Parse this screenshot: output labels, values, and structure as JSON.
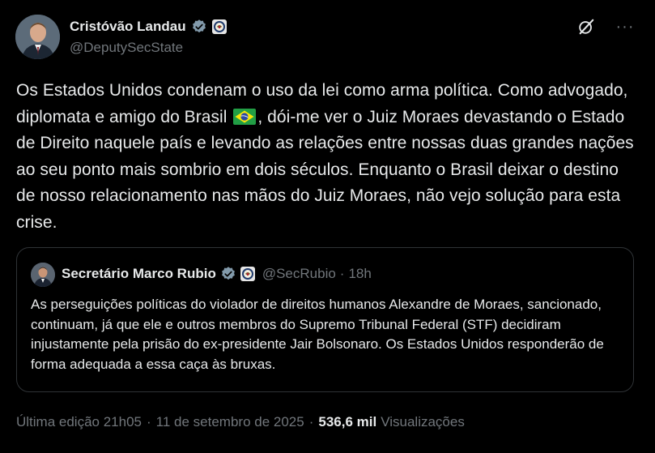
{
  "author": {
    "name": "Cristóvão Landau",
    "handle": "@DeputySecState"
  },
  "post": {
    "text_part1": "Os Estados Unidos condenam o uso da lei como arma política. Como advogado, diplomata e amigo do Brasil ",
    "text_part2": ", dói-me ver o Juiz Moraes devastando o Estado de Direito naquele país e levando as relações entre nossas duas grandes nações ao seu ponto mais sombrio em dois séculos. Enquanto o Brasil deixar o destino de nosso relacionamento nas mãos do Juiz Moraes, não vejo solução para esta crise."
  },
  "quoted": {
    "name": "Secretário Marco Rubio",
    "handle": "@SecRubio",
    "dot": "·",
    "time": "18h",
    "text": "As perseguições políticas do violador de direitos humanos Alexandre de Moraes, sancionado, continuam, já que ele e outros membros do Supremo Tribunal Federal (STF) decidiram injustamente pela prisão do ex-presidente Jair Bolsonaro. Os Estados Unidos responderão de forma adequada a essa caça às bruxas."
  },
  "meta": {
    "edited": "Última edição 21h05",
    "dot": "·",
    "date": "11 de setembro de 2025",
    "dot2": "·",
    "views_count": "536,6 mil",
    "views_label": "Visualizações"
  },
  "colors": {
    "background": "#000000",
    "text": "#e7e9ea",
    "secondary": "#71767b",
    "verified_gray": "#829aab",
    "border": "#2f3336"
  },
  "icons": {
    "verified": "verified-badge-icon",
    "seal": "government-seal-icon",
    "grok": "grok-icon",
    "more": "more-icon",
    "flag": "brazil-flag-emoji"
  }
}
